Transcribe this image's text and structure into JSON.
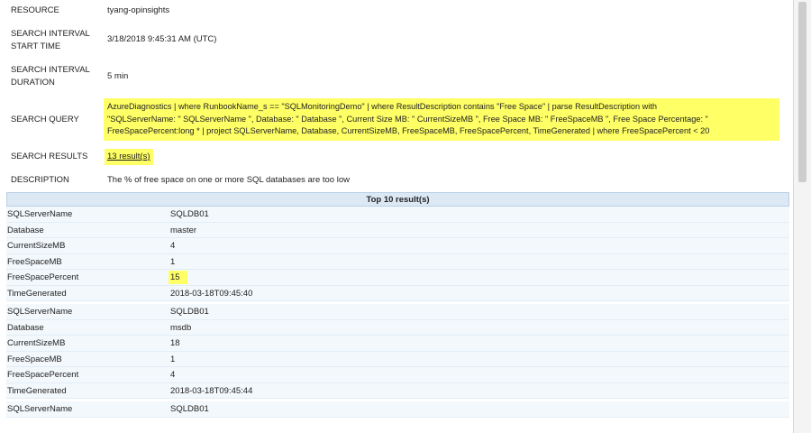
{
  "properties": {
    "resource_label": "RESOURCE",
    "resource_value": "tyang-opinsights",
    "start_label_1": "SEARCH INTERVAL",
    "start_label_2": "START TIME",
    "start_value": "3/18/2018 9:45:31 AM (UTC)",
    "duration_label_1": "SEARCH INTERVAL",
    "duration_label_2": "DURATION",
    "duration_value": "5 min",
    "query_label": "SEARCH QUERY",
    "query_line_1": "AzureDiagnostics | where RunbookName_s == \"SQLMonitoringDemo\" | where ResultDescription contains \"Free Space\" | parse ResultDescription with",
    "query_line_2": "\"SQLServerName: \" SQLServerName \", Database: \" Database \", Current Size MB: \" CurrentSizeMB \", Free Space MB: \" FreeSpaceMB \", Free Space Percentage: \"",
    "query_line_3": "FreeSpacePercent:long * | project SQLServerName, Database, CurrentSizeMB, FreeSpaceMB, FreeSpacePercent, TimeGenerated | where FreeSpacePercent < 20",
    "results_label": "SEARCH RESULTS",
    "results_value": "13 result(s)",
    "description_label": "DESCRIPTION",
    "description_value": "The % of free space on one or more SQL databases are too low"
  },
  "results_table": {
    "header": "Top 10 result(s)",
    "records": [
      [
        {
          "key": "SQLServerName",
          "value": "SQLDB01",
          "highlight": false
        },
        {
          "key": "Database",
          "value": "master",
          "highlight": false
        },
        {
          "key": "CurrentSizeMB",
          "value": "4",
          "highlight": false
        },
        {
          "key": "FreeSpaceMB",
          "value": "1",
          "highlight": false
        },
        {
          "key": "FreeSpacePercent",
          "value": "15",
          "highlight": true
        },
        {
          "key": "TimeGenerated",
          "value": "2018-03-18T09:45:40",
          "highlight": false
        }
      ],
      [
        {
          "key": "SQLServerName",
          "value": "SQLDB01",
          "highlight": false
        },
        {
          "key": "Database",
          "value": "msdb",
          "highlight": false
        },
        {
          "key": "CurrentSizeMB",
          "value": "18",
          "highlight": false
        },
        {
          "key": "FreeSpaceMB",
          "value": "1",
          "highlight": false
        },
        {
          "key": "FreeSpacePercent",
          "value": "4",
          "highlight": false
        },
        {
          "key": "TimeGenerated",
          "value": "2018-03-18T09:45:44",
          "highlight": false
        }
      ],
      [
        {
          "key": "SQLServerName",
          "value": "SQLDB01",
          "highlight": false
        }
      ]
    ]
  },
  "colors": {
    "highlight": "#ffff66",
    "table_header_bg": "#dce9f5",
    "table_row_bg": "#f3f8fc"
  }
}
